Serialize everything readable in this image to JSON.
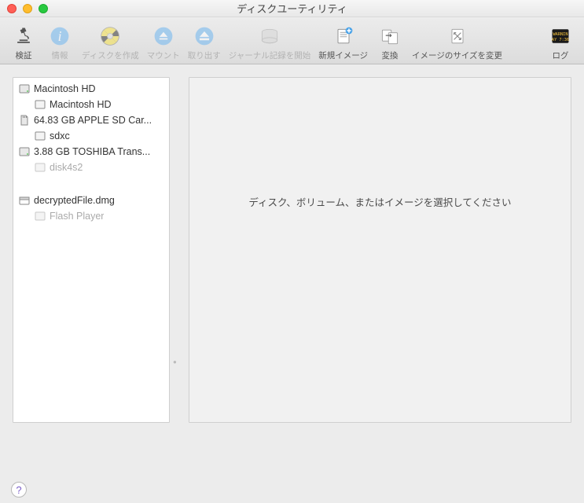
{
  "window": {
    "title": "ディスクユーティリティ"
  },
  "toolbar": {
    "verify": "検証",
    "info": "情報",
    "burn": "ディスクを作成",
    "mount": "マウント",
    "eject": "取り出す",
    "journal": "ジャーナル記録を開始",
    "newimage": "新規イメージ",
    "convert": "変換",
    "resize": "イメージのサイズを変更",
    "log": "ログ"
  },
  "sidebar": {
    "items": [
      {
        "label": "Macintosh HD",
        "icon": "hdd",
        "level": 0
      },
      {
        "label": "Macintosh HD",
        "icon": "volume",
        "level": 1
      },
      {
        "label": "64.83 GB APPLE SD Car...",
        "icon": "sd",
        "level": 0
      },
      {
        "label": "sdxc",
        "icon": "volume",
        "level": 1
      },
      {
        "label": "3.88 GB TOSHIBA Trans...",
        "icon": "usb",
        "level": 0
      },
      {
        "label": "disk4s2",
        "icon": "volume",
        "level": 1,
        "dim": true
      }
    ],
    "group2": [
      {
        "label": "decryptedFile.dmg",
        "icon": "dmg",
        "level": 0
      },
      {
        "label": "Flash Player",
        "icon": "volume",
        "level": 1,
        "dim": true
      }
    ]
  },
  "main": {
    "placeholder": "ディスク、ボリューム、またはイメージを選択してください"
  },
  "footer": {
    "help": "?"
  }
}
